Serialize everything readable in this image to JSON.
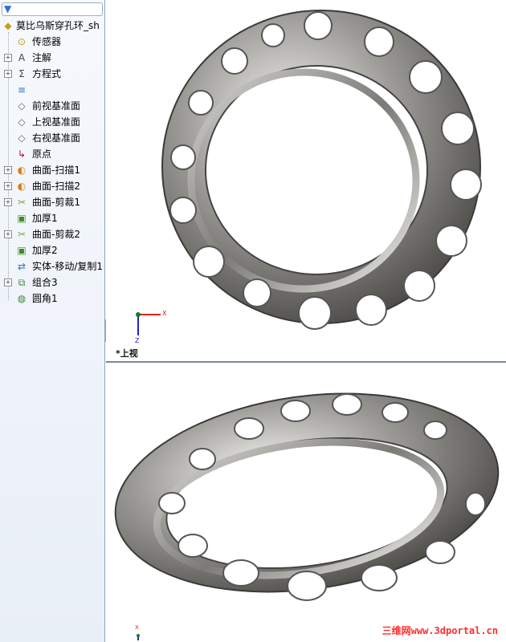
{
  "tree": {
    "root_label": "莫比乌斯穿孔环_sh",
    "items": [
      {
        "label": "传感器",
        "icon": "sensor-icon",
        "expandable": false
      },
      {
        "label": "注解",
        "icon": "annotation-icon",
        "expandable": true
      },
      {
        "label": "方程式",
        "icon": "equation-icon",
        "expandable": true
      },
      {
        "label": "",
        "icon": "material-icon",
        "expandable": false
      },
      {
        "label": "前视基准面",
        "icon": "plane-icon",
        "expandable": false
      },
      {
        "label": "上视基准面",
        "icon": "plane-icon",
        "expandable": false
      },
      {
        "label": "右视基准面",
        "icon": "plane-icon",
        "expandable": false
      },
      {
        "label": "原点",
        "icon": "origin-icon",
        "expandable": false
      },
      {
        "label": "曲面-扫描1",
        "icon": "sweep-surface-icon",
        "expandable": true
      },
      {
        "label": "曲面-扫描2",
        "icon": "sweep-surface-icon",
        "expandable": true
      },
      {
        "label": "曲面-剪裁1",
        "icon": "trim-surface-icon",
        "expandable": true
      },
      {
        "label": "加厚1",
        "icon": "thicken-icon",
        "expandable": false
      },
      {
        "label": "曲面-剪裁2",
        "icon": "trim-surface-icon",
        "expandable": true
      },
      {
        "label": "加厚2",
        "icon": "thicken-icon",
        "expandable": false
      },
      {
        "label": "实体-移动/复制1",
        "icon": "move-copy-icon",
        "expandable": false
      },
      {
        "label": "组合3",
        "icon": "combine-icon",
        "expandable": true
      },
      {
        "label": "圆角1",
        "icon": "fillet-icon",
        "expandable": false
      }
    ]
  },
  "viewport_top": {
    "label": "*上视",
    "triad": {
      "x": "X",
      "z": "Z"
    }
  },
  "viewport_bottom": {
    "triad": {
      "x": "X"
    }
  },
  "watermark": "三维网www.3dportal.cn",
  "colors": {
    "accent": "#2a6fd6",
    "tree_bg": "#edf2f9",
    "watermark": "#ff2d2d",
    "triad_x": "#d22",
    "triad_z": "#22c"
  }
}
